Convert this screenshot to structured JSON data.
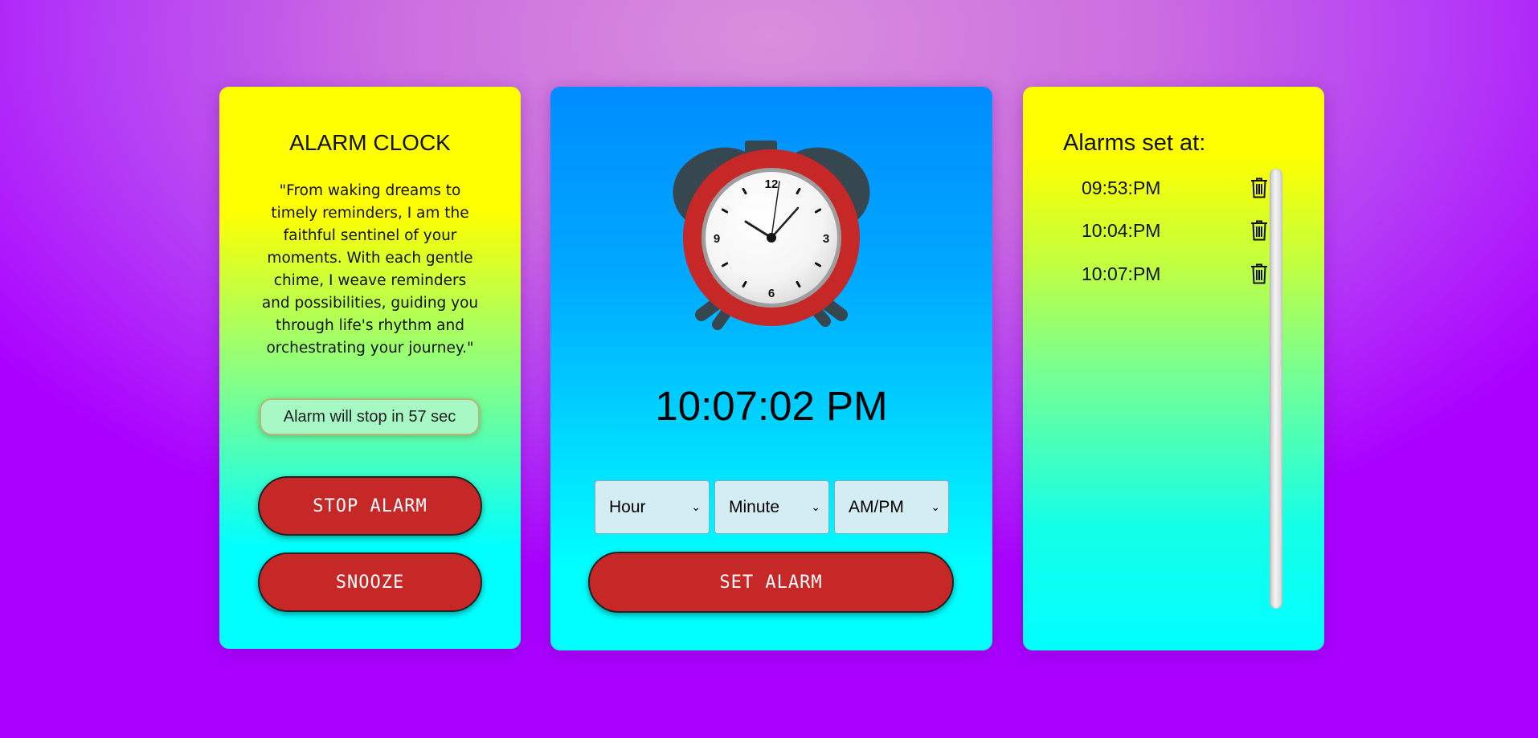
{
  "left": {
    "title": "ALARM CLOCK",
    "quote_lines": [
      "\"From waking dreams to",
      "timely reminders, I am the",
      "faithful sentinel of your",
      "moments. With each gentle",
      "chime, I weave reminders",
      "and possibilities, guiding you",
      "through life's rhythm and",
      "orchestrating your journey.\""
    ],
    "countdown": "Alarm will stop in 57 sec",
    "stop_label": "STOP ALARM",
    "snooze_label": "SNOOZE"
  },
  "center": {
    "clock_numbers": [
      "12",
      "3",
      "6",
      "9"
    ],
    "current_time": "10:07:02 PM",
    "selects": {
      "hour": "Hour",
      "minute": "Minute",
      "ampm": "AM/PM"
    },
    "set_label": "SET ALARM"
  },
  "right": {
    "title": "Alarms set at:",
    "alarms": [
      "09:53:PM",
      "10:04:PM",
      "10:07:PM"
    ]
  },
  "colors": {
    "button_red": "#c62828",
    "clock_ring": "#c62828",
    "bells": "#37474f"
  },
  "icons": {
    "delete": "trash-icon",
    "dropdown": "chevron-down-icon"
  }
}
